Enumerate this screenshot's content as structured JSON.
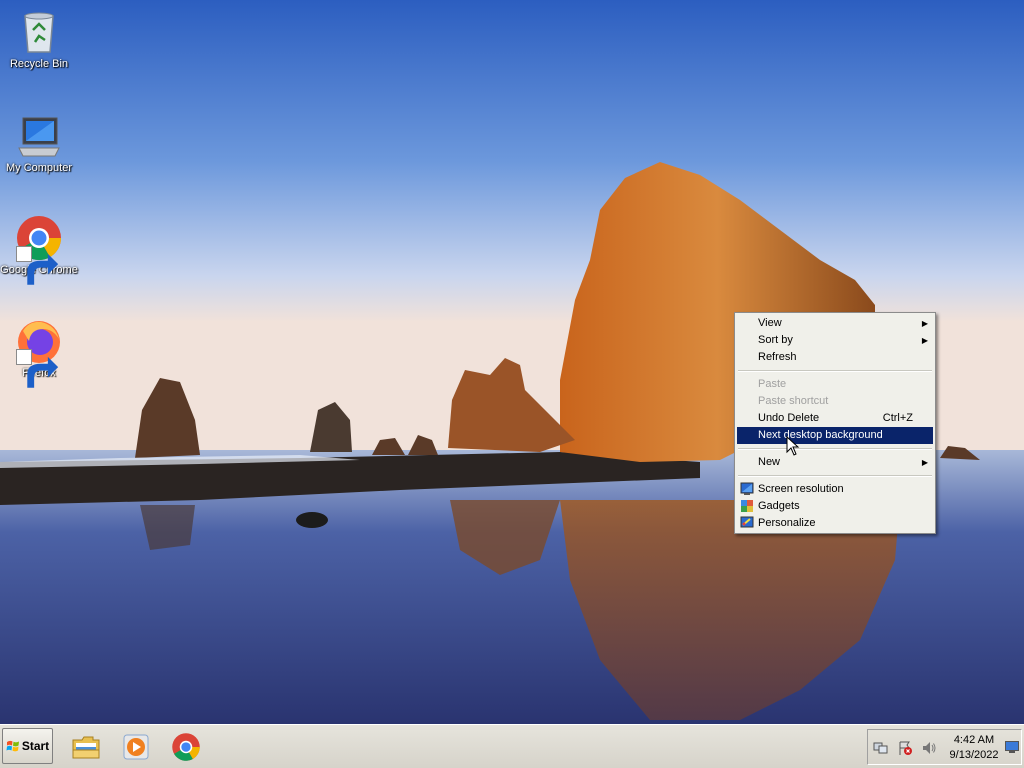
{
  "desktop": {
    "icons": [
      {
        "label": "Recycle Bin",
        "icon": "recycle-bin-icon"
      },
      {
        "label": "My Computer",
        "icon": "computer-icon"
      },
      {
        "label": "Google Chrome",
        "icon": "chrome-icon"
      },
      {
        "label": "Firefox",
        "icon": "firefox-icon"
      }
    ]
  },
  "context_menu": {
    "items": [
      {
        "label": "View",
        "submenu": true
      },
      {
        "label": "Sort by",
        "submenu": true
      },
      {
        "label": "Refresh"
      },
      {
        "label": "Paste",
        "disabled": true
      },
      {
        "label": "Paste shortcut",
        "disabled": true
      },
      {
        "label": "Undo Delete",
        "shortcut": "Ctrl+Z"
      },
      {
        "label": "Next desktop background",
        "highlighted": true
      },
      {
        "label": "New",
        "submenu": true
      },
      {
        "label": "Screen resolution",
        "icon": "screen-resolution-icon"
      },
      {
        "label": "Gadgets",
        "icon": "gadgets-icon"
      },
      {
        "label": "Personalize",
        "icon": "personalize-icon"
      }
    ]
  },
  "taskbar": {
    "start_label": "Start",
    "pinned": [
      {
        "name": "Windows Explorer",
        "icon": "folder-icon"
      },
      {
        "name": "Media Player",
        "icon": "media-player-icon"
      },
      {
        "name": "Google Chrome",
        "icon": "chrome-icon"
      }
    ],
    "clock": {
      "time": "4:42 AM",
      "date": "9/13/2022"
    }
  },
  "colors": {
    "menu_highlight": "#0a246a",
    "menu_background": "#f0f0ea",
    "taskbar": "#d6d3ca"
  }
}
